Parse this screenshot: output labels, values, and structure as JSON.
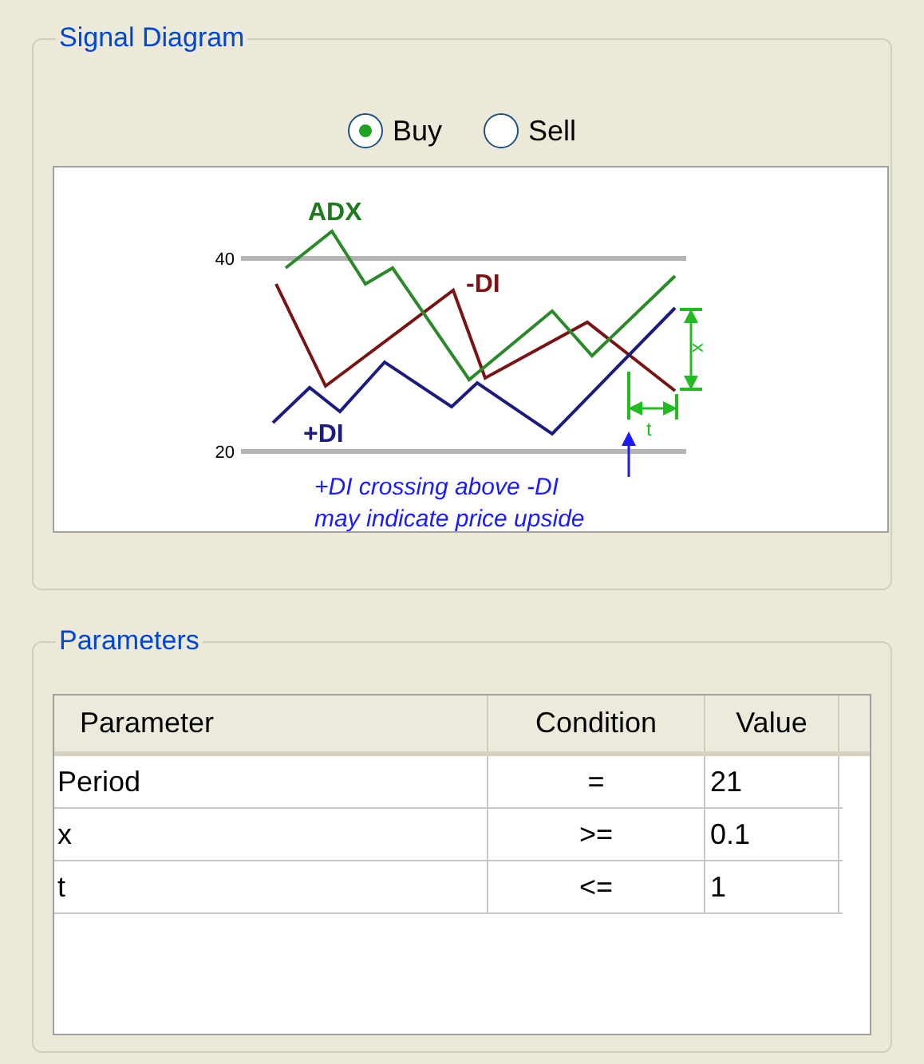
{
  "signal_diagram": {
    "title": "Signal Diagram",
    "radios": [
      {
        "label": "Buy",
        "selected": true
      },
      {
        "label": "Sell",
        "selected": false
      }
    ],
    "diagram": {
      "labels": {
        "adx": "ADX",
        "minus_di": "-DI",
        "plus_di": "+DI",
        "tick_high": "40",
        "tick_low": "20",
        "x": "x",
        "t": "t"
      },
      "caption": [
        "+DI crossing above -DI",
        "may indicate price upside"
      ]
    }
  },
  "parameters": {
    "title": "Parameters",
    "columns": [
      "Parameter",
      "Condition",
      "Value"
    ],
    "rows": [
      [
        "Period",
        "=",
        "21"
      ],
      [
        "x",
        ">=",
        "0.1"
      ],
      [
        "t",
        "<=",
        "1"
      ]
    ]
  }
}
